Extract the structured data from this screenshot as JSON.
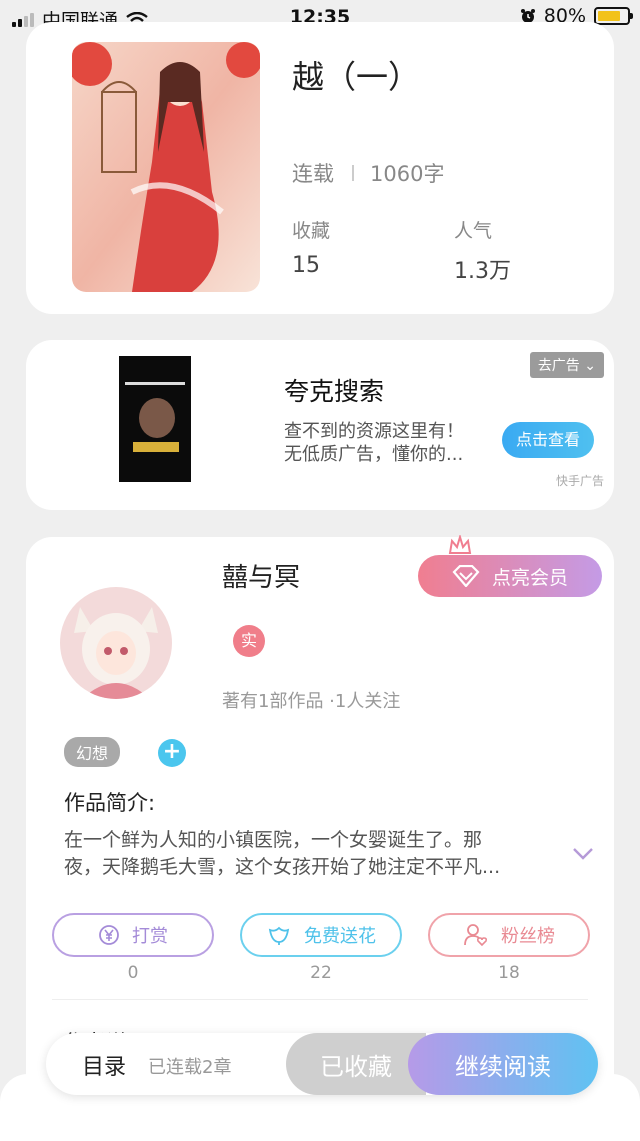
{
  "status_bar": {
    "carrier": "中国联通",
    "time": "12:35",
    "battery": "80%",
    "battery_level": 0.8,
    "icons": [
      "signal-icon",
      "wifi-icon",
      "alarm-icon",
      "battery-icon"
    ]
  },
  "book": {
    "title": "越（一）",
    "status": "连载",
    "word_count": "1060字",
    "stats": [
      {
        "label": "收藏",
        "value": "15"
      },
      {
        "label": "人气",
        "value": "1.3万"
      }
    ]
  },
  "ad": {
    "title": "夸克搜索",
    "desc_line1": "查不到的资源这里有！",
    "desc_line2": "无低质广告，懂你的...",
    "remove_label": "去广告",
    "button_label": "点击查看",
    "source": "快手广告"
  },
  "author": {
    "name": "囍与冥",
    "vip_label": "点亮会员",
    "real_badge": "实",
    "meta": "著有1部作品 ·1人关注",
    "tag": "幻想",
    "tag_add": "+",
    "intro_label": "作品简介:",
    "intro_line1": "在一个鲜为人知的小镇医院，一个女婴诞生了。那",
    "intro_line2": "夜，天降鹅毛大雪，这个女孩开始了她注定不平凡...",
    "actions": [
      {
        "label": "打赏",
        "count": "0",
        "icon": "yuan-icon"
      },
      {
        "label": "免费送花",
        "count": "22",
        "icon": "flower-icon"
      },
      {
        "label": "粉丝榜",
        "count": "18",
        "icon": "fan-icon"
      }
    ],
    "cut_text": "作者说"
  },
  "bottom_bar": {
    "toc_label": "目录",
    "chapters": "已连载2章",
    "collected_label": "已收藏",
    "continue_label": "继续阅读"
  },
  "colors": {
    "vip_gradient": [
      "#f07e90",
      "#c49be6"
    ],
    "continue_gradient": [
      "#b69ae8",
      "#5fc2f2"
    ],
    "ad_button": "#3aaaf2"
  }
}
